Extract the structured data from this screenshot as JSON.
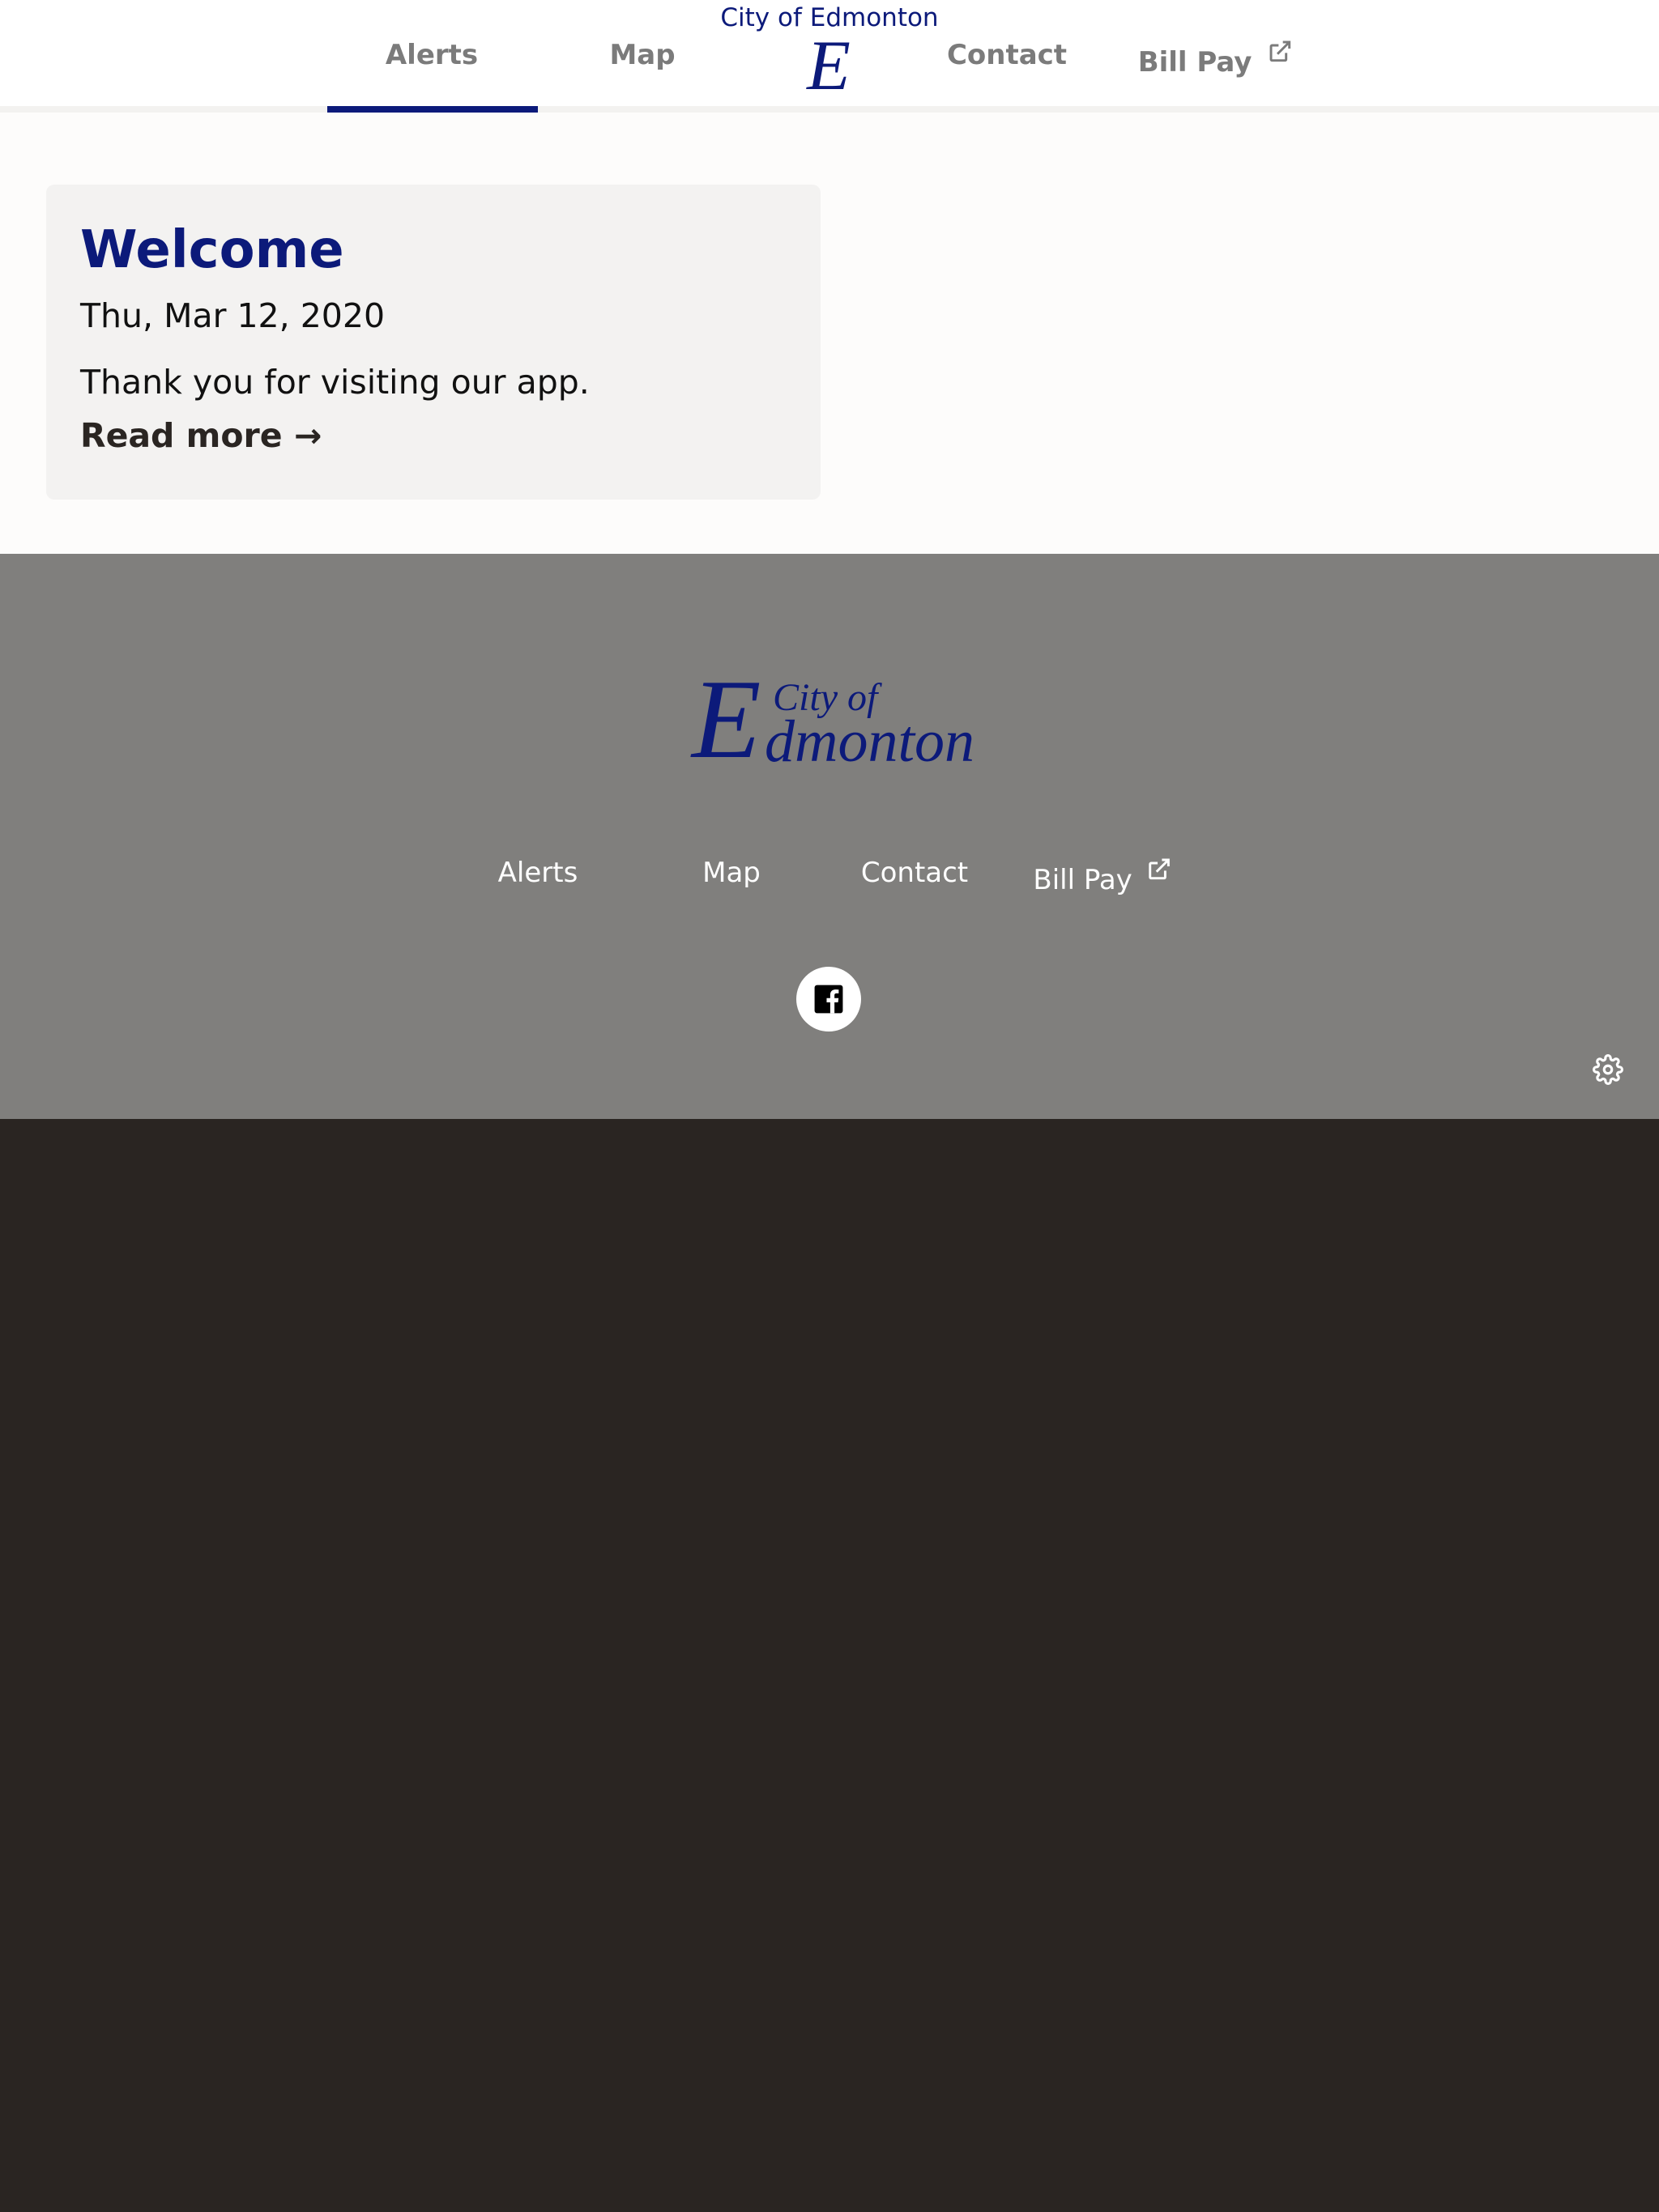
{
  "header": {
    "title": "City of Edmonton",
    "logo_letter": "E",
    "nav": [
      {
        "label": "Alerts",
        "active": true
      },
      {
        "label": "Map"
      },
      {
        "label": "Contact"
      },
      {
        "label": "Bill Pay",
        "external": true
      }
    ]
  },
  "card": {
    "title": "Welcome",
    "date": "Thu, Mar 12, 2020",
    "message": "Thank you for visiting our app.",
    "link": "Read more →"
  },
  "footer": {
    "logo": {
      "letter": "E",
      "line1": "City of",
      "line2": "dmonton"
    },
    "nav": [
      {
        "label": "Alerts"
      },
      {
        "label": "Map"
      },
      {
        "label": "Contact"
      },
      {
        "label": "Bill Pay",
        "external": true
      }
    ],
    "social": [
      "facebook-icon"
    ],
    "settings_icon": "gear-icon"
  },
  "colors": {
    "brand": "#0c1a7a",
    "footer_bg": "#807f7d",
    "page_bg": "#2a2522"
  }
}
